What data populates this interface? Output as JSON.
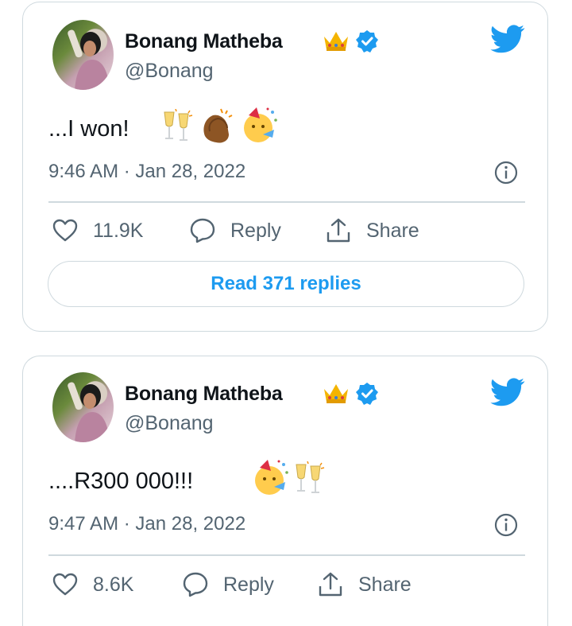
{
  "colors": {
    "accent": "#1d9bf0",
    "muted": "#536471",
    "border": "#cfd9de"
  },
  "tweets": [
    {
      "name": "Bonang Matheba",
      "handle": "@Bonang",
      "text": "...I won!",
      "emojis": [
        "clinking-glasses",
        "clapping-hands",
        "party-face"
      ],
      "time": "9:46 AM · Jan 28, 2022",
      "likes": "11.9K",
      "reply_label": "Reply",
      "share_label": "Share",
      "read_replies": "Read 371 replies"
    },
    {
      "name": "Bonang Matheba",
      "handle": "@Bonang",
      "text": "....R300 000!!!",
      "emojis": [
        "party-face",
        "clinking-glasses"
      ],
      "time": "9:47 AM · Jan 28, 2022",
      "likes": "8.6K",
      "reply_label": "Reply",
      "share_label": "Share"
    }
  ]
}
